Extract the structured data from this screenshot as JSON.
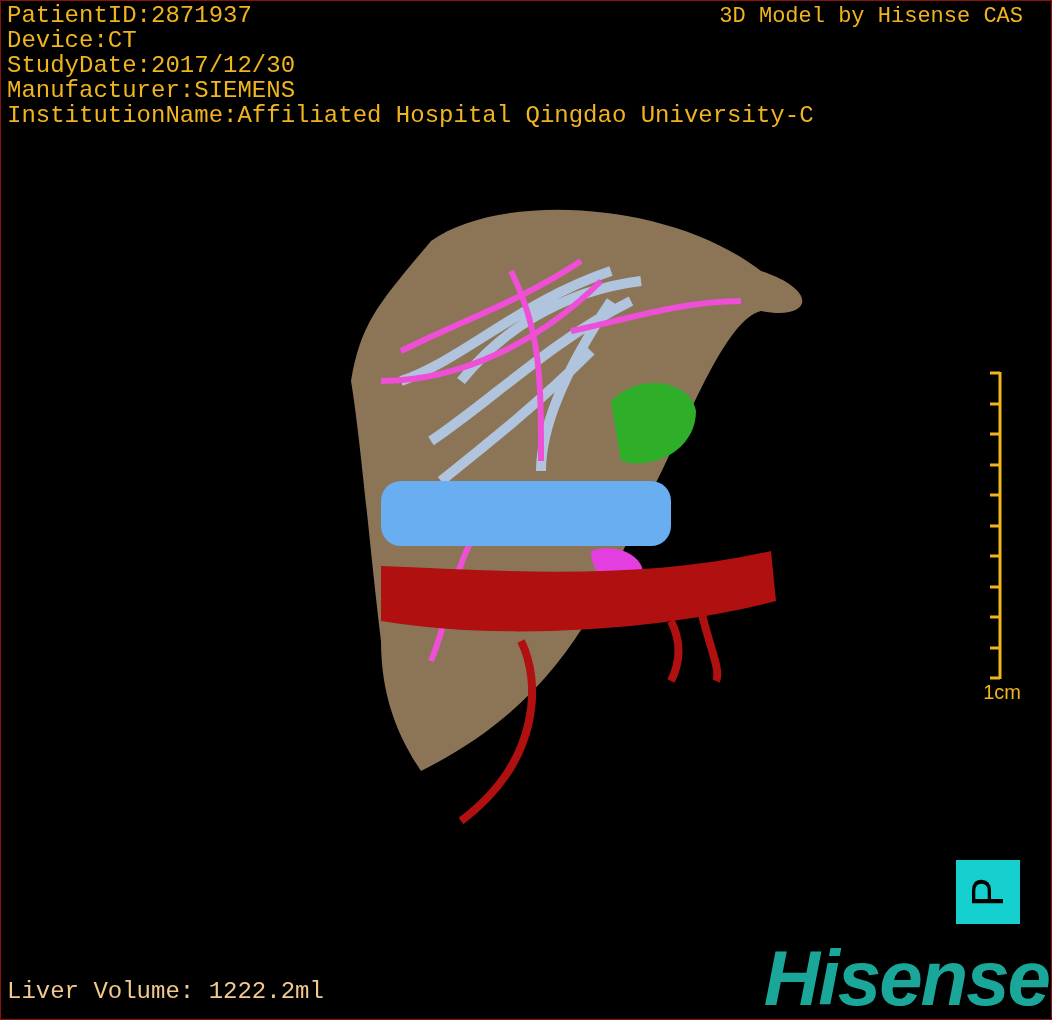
{
  "info_lines": [
    "PatientID:2871937",
    "Device:CT",
    "StudyDate:2017/12/30",
    "Manufacturer:SIEMENS",
    "InstitutionName:Affiliated Hospital Qingdao University-C"
  ],
  "watermark_title": "3D Model by Hisense CAS",
  "scale": {
    "label": "1cm"
  },
  "orientation": {
    "label": "P"
  },
  "volume": "Liver Volume: 1222.2ml",
  "logo": "Hisense"
}
